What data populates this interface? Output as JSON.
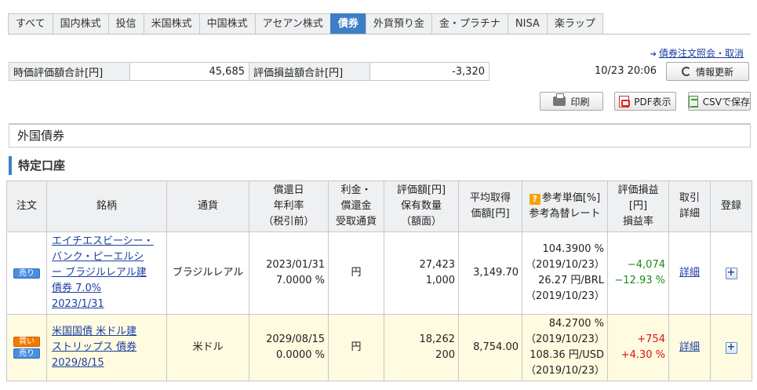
{
  "tabs": [
    {
      "label": "すべて"
    },
    {
      "label": "国内株式"
    },
    {
      "label": "投信"
    },
    {
      "label": "米国株式"
    },
    {
      "label": "中国株式"
    },
    {
      "label": "アセアン株式"
    },
    {
      "label": "債券"
    },
    {
      "label": "外貨預り金"
    },
    {
      "label": "金・プラチナ"
    },
    {
      "label": "NISA"
    },
    {
      "label": "楽ラップ"
    }
  ],
  "active_tab": "債券",
  "links": {
    "order_inquiry": "債券注文照会・取消"
  },
  "summary": {
    "market_value_label": "時価評価額合計[円]",
    "market_value": "45,685",
    "unrealized_pl_label": "評価損益額合計[円]",
    "unrealized_pl": "-3,320"
  },
  "timestamp": "10/23 20:06",
  "buttons": {
    "refresh": "情報更新",
    "print": "印刷",
    "pdf": "PDF表示",
    "csv": "CSVで保存"
  },
  "section": {
    "title": "外国債券",
    "account": "特定口座"
  },
  "columns": {
    "order": "注文",
    "name": "銘柄",
    "currency": "通貨",
    "redemption_l1": "償還日",
    "redemption_l2": "年利率",
    "redemption_l3": "（税引前）",
    "interest_l1": "利金・",
    "interest_l2": "償還金",
    "interest_l3": "受取通貨",
    "value_l1": "評価額[円]",
    "value_l2": "保有数量",
    "value_l3": "（額面）",
    "avg_l1": "平均取得",
    "avg_l2": "価額[円]",
    "ref_l1": "参考単価[%]",
    "ref_l2": "参考為替レート",
    "pl_l1": "評価損益",
    "pl_l2": "[円]",
    "pl_l3": "損益率",
    "detail_l1": "取引",
    "detail_l2": "詳細",
    "register": "登録"
  },
  "badges": {
    "buy": "買い",
    "sell": "売り"
  },
  "help_icon": "?",
  "rows": [
    {
      "name_l1": "エイチエスビーシー・",
      "name_l2": "バンク・ピーエルシ",
      "name_l3": "ー ブラジルレアル建",
      "name_l4": "債券 7.0%",
      "name_l5": "2023/1/31",
      "currency": "ブラジルレアル",
      "redemption_date": "2023/01/31",
      "rate": "7.0000 %",
      "interest_currency": "円",
      "value": "27,423",
      "quantity": "1,000",
      "avg_price": "3,149.70",
      "ref_price": "104.3900 %",
      "ref_price_date": "（2019/10/23）",
      "fx_rate": "26.27 円/BRL",
      "fx_date": "（2019/10/23）",
      "pl": "−4,074",
      "pl_rate": "−12.93 %",
      "detail": "詳細"
    },
    {
      "name_l1": "米国国債 米ドル建",
      "name_l2": "ストリップス 債券",
      "name_l3": "2029/8/15",
      "currency": "米ドル",
      "redemption_date": "2029/08/15",
      "rate": "0.0000 %",
      "interest_currency": "円",
      "value": "18,262",
      "quantity": "200",
      "avg_price": "8,754.00",
      "ref_price": "84.2700 %",
      "ref_price_date": "（2019/10/23）",
      "fx_rate": "108.36 円/USD",
      "fx_date": "（2019/10/23）",
      "pl": "+754",
      "pl_rate": "+4.30 %",
      "detail": "詳細"
    }
  ],
  "colors": {
    "accent": "#3d7fc7",
    "negative": "#1a8a1a",
    "positive": "#dd1111",
    "header_bg": "#eef0f2",
    "highlight_row": "#fffbe0"
  }
}
